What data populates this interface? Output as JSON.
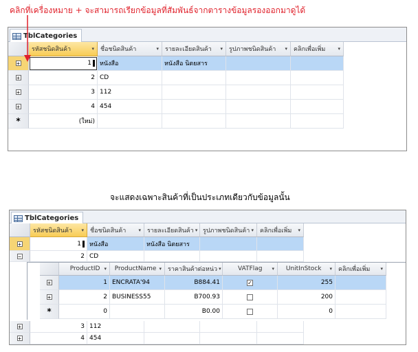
{
  "annotations": {
    "top_caption": "คลิกที่เครื่องหมาย + จะสามารถเรียกข้อมูลที่สัมพันธ์จากตารางข้อมูลรองออกมาดูได้",
    "middle_caption": "จะแสดงเฉพาะสินค้าที่เป็นประเภทเดียวกับข้อมูลนั้น"
  },
  "table_tab": "TblCategories",
  "columns": [
    "รหัสชนิดสินค้า",
    "ชื่อชนิดสินค้า",
    "รายละเอียดสินค้า",
    "รูปภาพชนิดสินค้า",
    "คลิกเพื่อเพิ่ม"
  ],
  "top_rows": [
    {
      "id": "1",
      "name": "หนังสือ",
      "detail": "หนังสือ นิตยสาร"
    },
    {
      "id": "2",
      "name": "CD",
      "detail": ""
    },
    {
      "id": "3",
      "name": "112",
      "detail": ""
    },
    {
      "id": "4",
      "name": "454",
      "detail": ""
    }
  ],
  "new_row_label": "(ใหม่)",
  "new_row_symbol": "*",
  "expand_symbol": "+",
  "collapse_symbol": "−",
  "bottom_rows": [
    {
      "id": "1",
      "name": "หนังสือ",
      "detail": "หนังสือ นิตยสาร"
    },
    {
      "id": "2",
      "name": "CD",
      "detail": ""
    },
    {
      "id": "3",
      "name": "112",
      "detail": ""
    },
    {
      "id": "4",
      "name": "454",
      "detail": ""
    }
  ],
  "subtable": {
    "columns": [
      "ProductID",
      "ProductName",
      "ราคาสินค้าต่อหน่ว",
      "VATFlag",
      "UnitInStock",
      "คลิกเพื่อเพิ่ม"
    ],
    "rows": [
      {
        "id": "1",
        "name": "ENCRATA'94",
        "price": "B884.41",
        "vat": true,
        "stock": "255"
      },
      {
        "id": "2",
        "name": "BUSINESS55",
        "price": "B700.93",
        "vat": false,
        "stock": "200"
      }
    ],
    "new_row": {
      "id": "0",
      "name": "",
      "price": "B0.00",
      "vat": false,
      "stock": "0"
    }
  },
  "colors": {
    "header_selected": "#f8cc55",
    "row_selected": "#b9d7f6",
    "annotation_red": "#e0202a",
    "arrow_red": "#e0202a"
  },
  "icons": {
    "tab": "table-icon",
    "expand": "plus-box-icon",
    "collapse": "minus-box-icon",
    "new_row": "asterisk-icon",
    "check": "checkmark-icon"
  }
}
